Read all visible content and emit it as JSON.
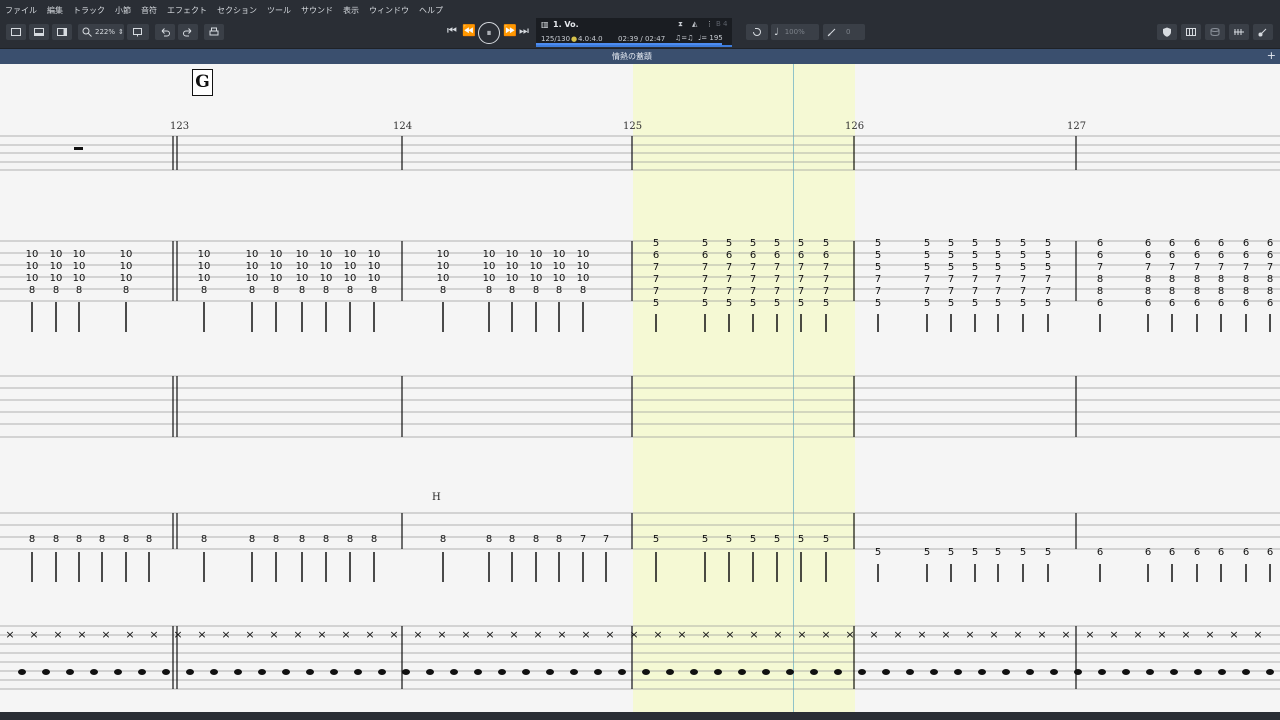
{
  "menu": [
    "ファイル",
    "編集",
    "トラック",
    "小節",
    "音符",
    "エフェクト",
    "セクション",
    "ツール",
    "サウンド",
    "表示",
    "ウィンドウ",
    "ヘルプ"
  ],
  "toolbar": {
    "zoom": "222%"
  },
  "lcd": {
    "track": "1. Vo.",
    "bar_position": "125/130",
    "time_signature": "4.0:4.0",
    "time": "02:39 / 02:47",
    "triplet_feel": "♫=♫",
    "tempo_label": "♩= 195",
    "key": "B 4",
    "progress": 0.95
  },
  "volume": "100%",
  "score": {
    "title": "情熱の蓋蹟",
    "section_letter": "G",
    "bar_numbers": [
      "123",
      "124",
      "125",
      "126",
      "127"
    ],
    "technique_label": "H"
  }
}
